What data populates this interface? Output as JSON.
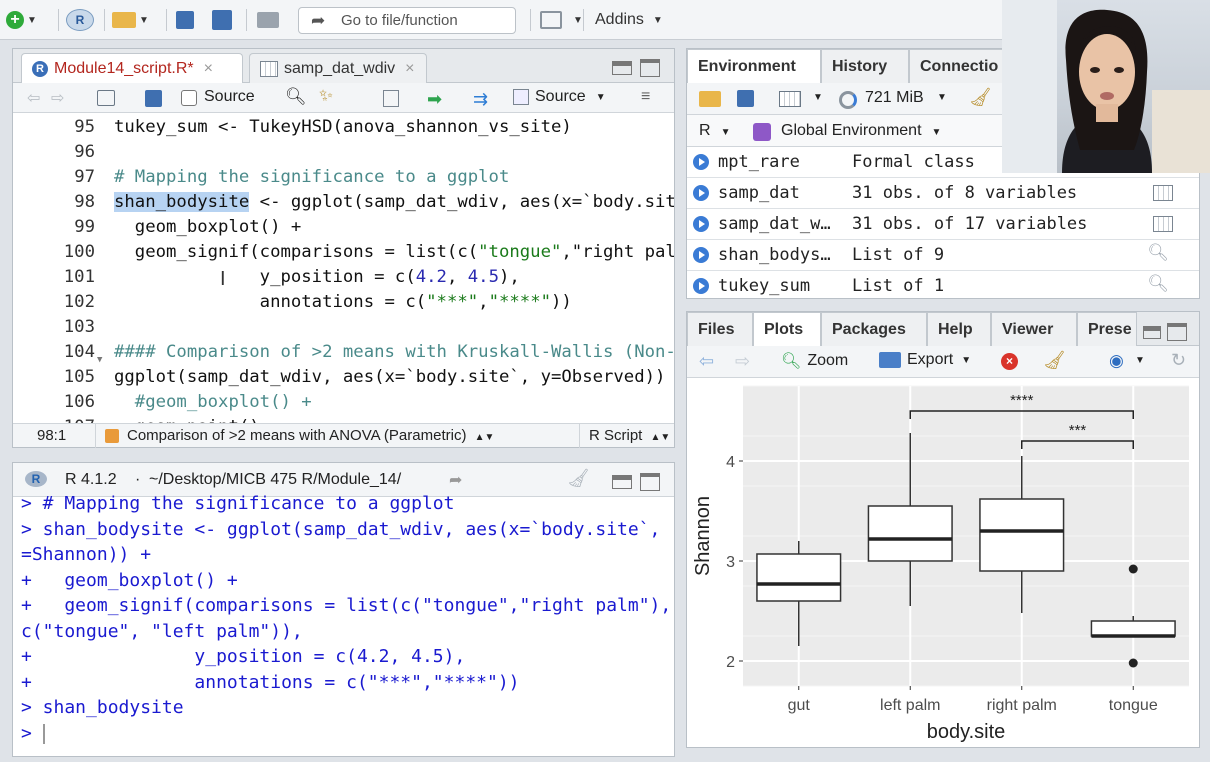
{
  "toolbar": {
    "goto_placeholder": "Go to file/function",
    "addins_label": "Addins"
  },
  "editor": {
    "tabs": [
      {
        "label": "Module14_script.R*"
      },
      {
        "label": "samp_dat_wdiv"
      }
    ],
    "source_on_save_label": "Source",
    "source_button_label": "Source",
    "lines": [
      {
        "num": "95",
        "text": "tukey_sum <- TukeyHSD(anova_shannon_vs_site)"
      },
      {
        "num": "96",
        "text": ""
      },
      {
        "num": "97",
        "text": "# Mapping the significance to a ggplot"
      },
      {
        "num": "98",
        "text": "shan_bodysite <- ggplot(samp_dat_wdiv, aes(x=`body.sit"
      },
      {
        "num": "99",
        "text": "  geom_boxplot() +"
      },
      {
        "num": "100",
        "text": "  geom_signif(comparisons = list(c(\"tongue\",\"right pal"
      },
      {
        "num": "101",
        "text": "              y_position = c(4.2, 4.5),"
      },
      {
        "num": "102",
        "text": "              annotations = c(\"***\",\"****\"))"
      },
      {
        "num": "103",
        "text": ""
      },
      {
        "num": "104",
        "text": "#### Comparison of >2 means with Kruskall-Wallis (Non-"
      },
      {
        "num": "105",
        "text": "ggplot(samp_dat_wdiv, aes(x=`body.site`, y=Observed))"
      },
      {
        "num": "106",
        "text": "  #geom_boxplot() +"
      },
      {
        "num": "107",
        "text": "  geom_point()"
      }
    ],
    "status": {
      "position": "98:1",
      "section": "Comparison of >2 means with ANOVA (Parametric)",
      "filetype": "R Script"
    }
  },
  "console": {
    "version": "R 4.1.2",
    "path": "~/Desktop/MICB 475 R/Module_14/",
    "lines": [
      "> # Mapping the significance to a ggplot",
      "> shan_bodysite <- ggplot(samp_dat_wdiv, aes(x=`body.site`, y",
      "=Shannon)) +",
      "+   geom_boxplot() +",
      "+   geom_signif(comparisons = list(c(\"tongue\",\"right palm\"),",
      "c(\"tongue\", \"left palm\")),",
      "+               y_position = c(4.2, 4.5),",
      "+               annotations = c(\"***\",\"****\"))",
      "> shan_bodysite",
      "> "
    ]
  },
  "environment": {
    "tabs": [
      {
        "label": "Environment"
      },
      {
        "label": "History"
      },
      {
        "label": "Connectio"
      }
    ],
    "memory": "721 MiB",
    "lang": "R",
    "scope": "Global Environment",
    "rows": [
      {
        "name": "mpt_rare",
        "value": "Formal class"
      },
      {
        "name": "samp_dat",
        "value": "31 obs. of 8 variables"
      },
      {
        "name": "samp_dat_w…",
        "value": "31 obs. of 17 variables"
      },
      {
        "name": "shan_bodys…",
        "value": "List of  9"
      },
      {
        "name": "tukey_sum",
        "value": "List of  1"
      }
    ]
  },
  "files": {
    "tabs": [
      {
        "label": "Files"
      },
      {
        "label": "Plots"
      },
      {
        "label": "Packages"
      },
      {
        "label": "Help"
      },
      {
        "label": "Viewer"
      },
      {
        "label": "Prese"
      }
    ],
    "zoom_label": "Zoom",
    "export_label": "Export"
  },
  "chart_data": {
    "type": "boxplot",
    "xlabel": "body.site",
    "ylabel": "Shannon",
    "ylim": [
      1.75,
      4.75
    ],
    "yticks": [
      2,
      3,
      4
    ],
    "categories": [
      "gut",
      "left palm",
      "right palm",
      "tongue"
    ],
    "boxes": [
      {
        "category": "gut",
        "min": 2.15,
        "q1": 2.6,
        "median": 2.77,
        "q3": 3.07,
        "max": 3.2,
        "outliers": []
      },
      {
        "category": "left palm",
        "min": 2.55,
        "q1": 3.0,
        "median": 3.22,
        "q3": 3.55,
        "max": 4.28,
        "outliers": []
      },
      {
        "category": "right palm",
        "min": 2.48,
        "q1": 2.9,
        "median": 3.3,
        "q3": 3.62,
        "max": 4.05,
        "outliers": []
      },
      {
        "category": "tongue",
        "min": 2.25,
        "q1": 2.25,
        "median": 2.25,
        "q3": 2.4,
        "max": 2.45,
        "outliers": [
          2.92,
          1.98
        ]
      }
    ],
    "annotations": [
      {
        "from": "left palm",
        "to": "tongue",
        "y": 4.5,
        "label": "****"
      },
      {
        "from": "right palm",
        "to": "tongue",
        "y": 4.2,
        "label": "***"
      }
    ],
    "grid": true,
    "background": "#ebebeb"
  }
}
